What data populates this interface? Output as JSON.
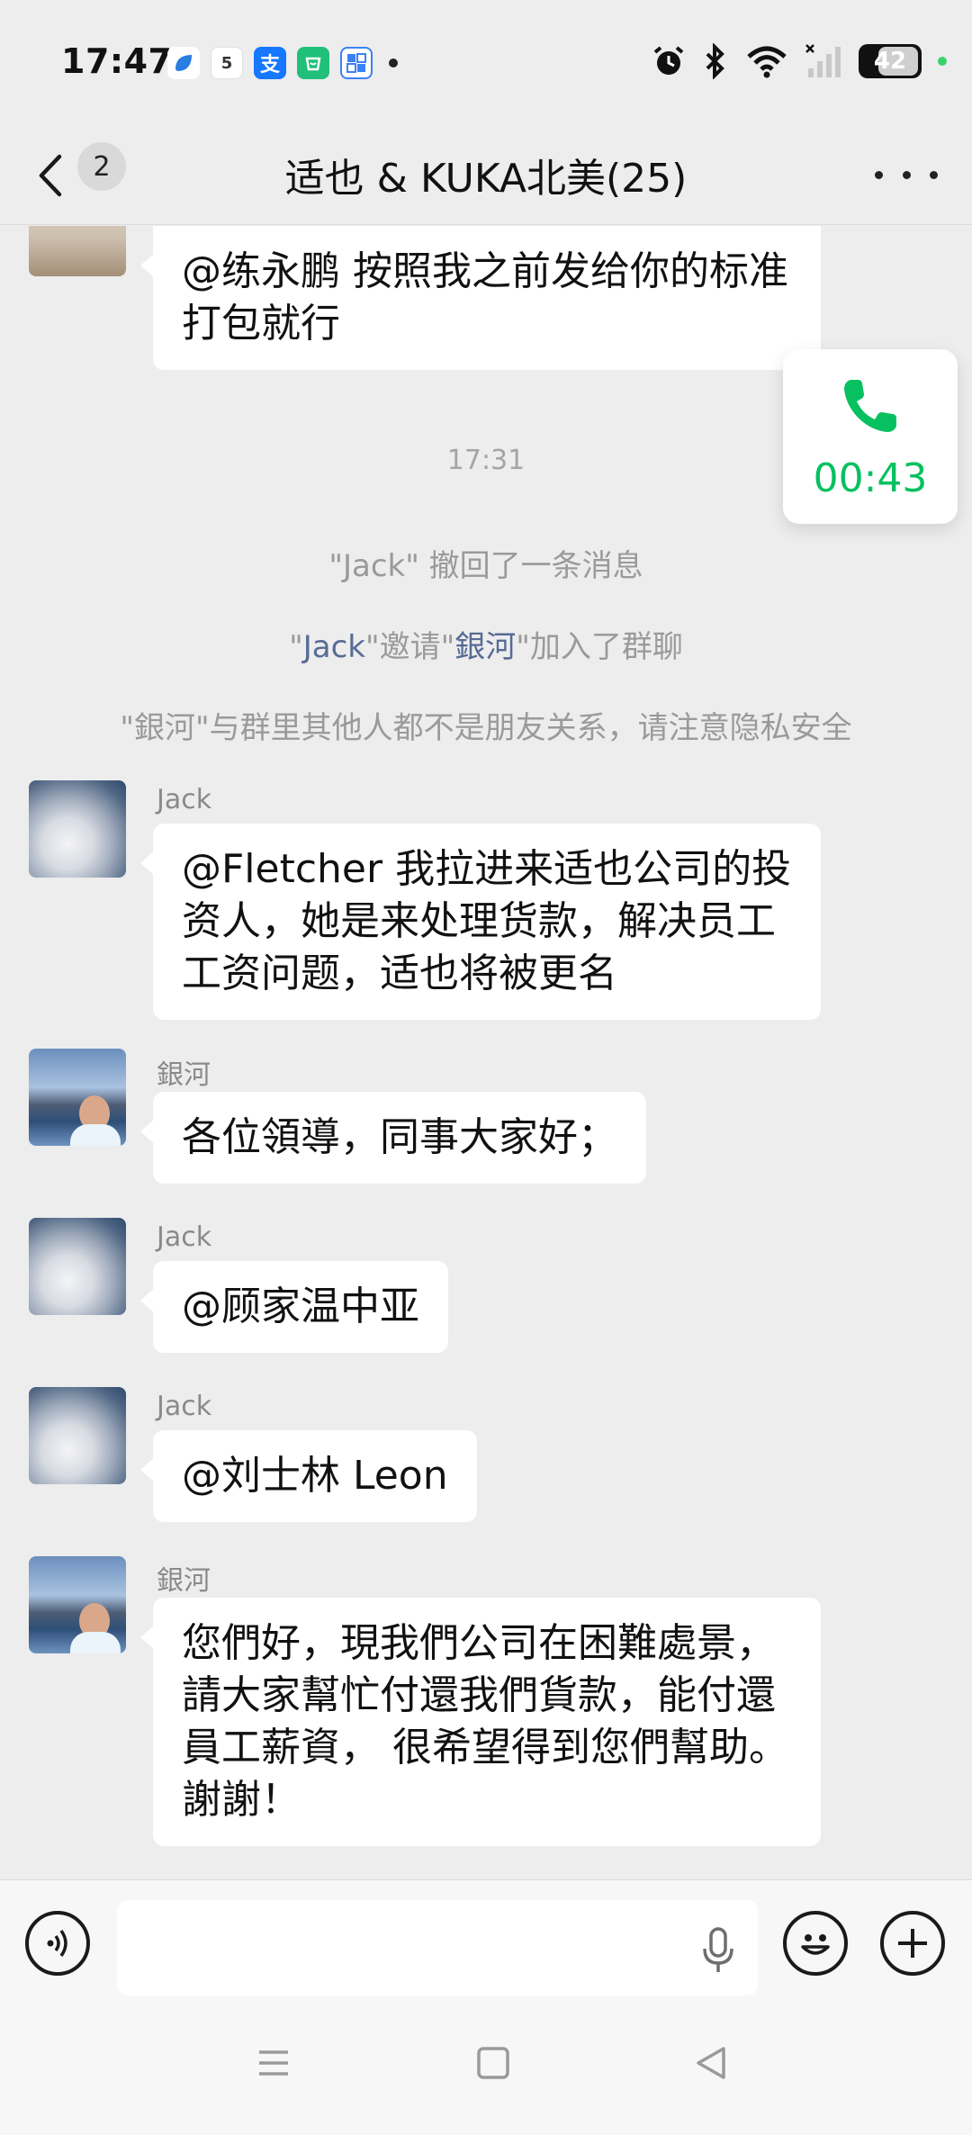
{
  "status_bar": {
    "time": "17:47",
    "battery": "42",
    "notification_apps": [
      "blue-app-icon",
      "calendar-5-icon",
      "alipay-icon",
      "green-app-icon",
      "grid-app-icon"
    ],
    "calendar_day": "5"
  },
  "navbar": {
    "unread_count": "2",
    "title": "适也 & KUKA北美(25)"
  },
  "call_widget": {
    "duration": "00:43",
    "accent_color": "#07c160"
  },
  "messages": {
    "m0_text": "@练永鹏  按照我之前发给你的标准打包就行",
    "timestamp": "17:31",
    "sys_recall": "\"Jack\" 撤回了一条消息",
    "sys_invite_q1": "\"",
    "sys_invite_name1": "Jack",
    "sys_invite_mid": "\"邀请\"",
    "sys_invite_name2": "銀河",
    "sys_invite_end": "\"加入了群聊",
    "sys_privacy": "\"銀河\"与群里其他人都不是朋友关系，请注意隐私安全",
    "m1_sender": "Jack",
    "m1_text": "@Fletcher  我拉进来适也公司的投资人，她是来处理货款，解决员工工资问题，适也将被更名",
    "m2_sender": "銀河",
    "m2_text": "各位領導，同事大家好；",
    "m3_sender": "Jack",
    "m3_text": "@顾家温中亚",
    "m4_sender": "Jack",
    "m4_text": "@刘士林 Leon",
    "m5_sender": "銀河",
    "m5_text": "您們好，現我們公司在困難處景，請大家幫忙付還我們貨款，能付還員工薪資， 很希望得到您們幫助。謝謝！"
  },
  "colors": {
    "chat_bg": "#ededed",
    "link_name": "#576b95"
  }
}
